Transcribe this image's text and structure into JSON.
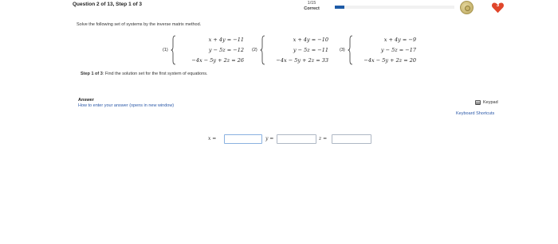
{
  "header": {
    "question": "Question 2 of 13, Step 1 of 3",
    "score": "1/15",
    "status": "Correct",
    "progress": 0.08,
    "hearts": "3"
  },
  "instructions": "Solve the following set of systems by the inverse matrix method.",
  "systems": [
    {
      "label": "(1)",
      "eqs": [
        "x + 4y = −11",
        "y − 5z = −12",
        "−4x − 5y + 2z = 26"
      ]
    },
    {
      "label": "(2)",
      "eqs": [
        "x + 4y = −10",
        "y − 5z = −11",
        "−4x − 5y + 2z = 33"
      ]
    },
    {
      "label": "(3)",
      "eqs": [
        "x + 4y = −9",
        "y − 5z = −17",
        "−4x − 5y + 2z = 20"
      ]
    }
  ],
  "step": {
    "prefix": "Step 1 of 3",
    "text": ":  Find the solution set for the first system of equations."
  },
  "answer": {
    "label": "Answer",
    "help_link": "How to enter your answer (opens in new window)"
  },
  "tools": {
    "keypad": "Keypad",
    "shortcuts": "Keyboard Shortcuts"
  },
  "inputs": [
    {
      "label": "x =",
      "value": ""
    },
    {
      "label": "y =",
      "value": ""
    },
    {
      "label": "z =",
      "value": ""
    }
  ],
  "colors": {
    "progress_fill": "#1d5aa6",
    "heart": "#e0462b",
    "link": "#2a58a8"
  }
}
